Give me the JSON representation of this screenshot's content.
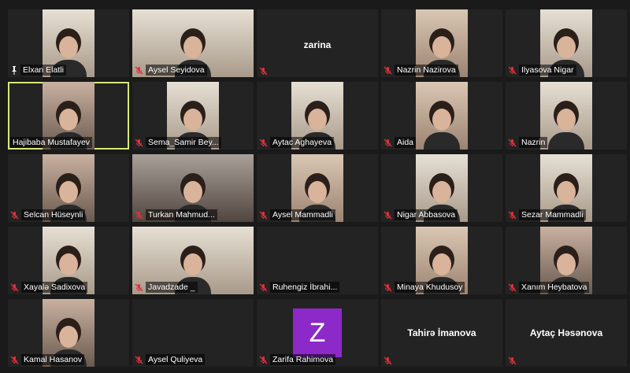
{
  "participants": [
    {
      "name": "Elxan Elatli",
      "icon": "pin-icon",
      "video": true,
      "pinned": true
    },
    {
      "name": "Aysel Seyidova",
      "icon": "muted-mic-icon",
      "video": true
    },
    {
      "name": "",
      "display_name": "zarina",
      "icon": "muted-mic-icon",
      "video": false
    },
    {
      "name": "Nazrin Nazirova",
      "icon": "muted-mic-icon",
      "video": true
    },
    {
      "name": "Ilyasova Nigar",
      "icon": "muted-mic-icon",
      "video": true
    },
    {
      "name": "Hajibaba Mustafayev",
      "icon": "none",
      "video": true,
      "active_speaker": true
    },
    {
      "name": "Sema_Samir Bey...",
      "icon": "muted-mic-icon",
      "video": true
    },
    {
      "name": "Aytac Aghayeva",
      "icon": "muted-mic-icon",
      "video": true
    },
    {
      "name": "Aida",
      "icon": "muted-mic-icon",
      "video": true
    },
    {
      "name": "Nazrin",
      "icon": "muted-mic-icon",
      "video": true
    },
    {
      "name": "Selcan Hüseynli",
      "icon": "muted-mic-icon",
      "video": true
    },
    {
      "name": "Turkan Mahmud...",
      "icon": "muted-mic-icon",
      "video": true
    },
    {
      "name": "Aysel Mammadli",
      "icon": "muted-mic-icon",
      "video": true
    },
    {
      "name": "Nigar Abbasova",
      "icon": "muted-mic-icon",
      "video": true
    },
    {
      "name": "Sezar Mammadli",
      "icon": "muted-mic-icon",
      "video": true
    },
    {
      "name": "Xayalə Sadixova",
      "icon": "muted-mic-icon",
      "video": true
    },
    {
      "name": "Javadzade _",
      "icon": "muted-mic-icon",
      "video": true
    },
    {
      "name": "Ruhengiz İbrahi...",
      "icon": "muted-mic-icon",
      "video": false
    },
    {
      "name": "Minaya Khudusoy",
      "icon": "muted-mic-icon",
      "video": true
    },
    {
      "name": "Xanım Heybatova",
      "icon": "muted-mic-icon",
      "video": true
    },
    {
      "name": "Kamal Hasanov",
      "icon": "muted-mic-icon",
      "video": true
    },
    {
      "name": "Aysel Quliyeva",
      "icon": "muted-mic-icon",
      "video": false
    },
    {
      "name": "Zarifa Rahimova",
      "icon": "muted-mic-icon",
      "video": false,
      "avatar_letter": "Z",
      "avatar_color": "#8d29c9"
    },
    {
      "name": "",
      "display_name": "Tahirə İmanova",
      "icon": "muted-mic-icon",
      "video": false
    },
    {
      "name": "",
      "display_name": "Aytaç Həsənova",
      "icon": "muted-mic-icon",
      "video": false
    }
  ],
  "colors": {
    "background": "#1a1a1a",
    "tile": "#232323",
    "active_speaker_border": "#d7e87a",
    "muted_icon": "#e0303a"
  }
}
